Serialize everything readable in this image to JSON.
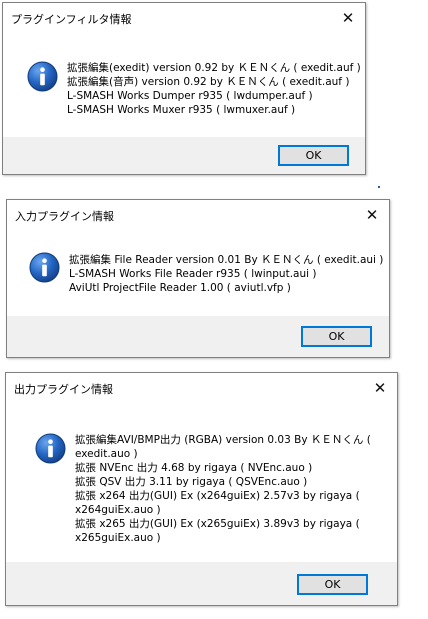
{
  "dialogs": [
    {
      "title": "プラグインフィルタ情報",
      "icon": "info-icon",
      "lines": [
        "拡張編集(exedit) version 0.92 by ＫＥＮくん ( exedit.auf )",
        "拡張編集(音声) version 0.92 by ＫＥＮくん ( exedit.auf )",
        "L-SMASH Works Dumper r935 ( lwdumper.auf )",
        "L-SMASH Works Muxer r935 ( lwmuxer.auf )"
      ],
      "ok_label": "OK",
      "close_label": "✕"
    },
    {
      "title": "入力プラグイン情報",
      "icon": "info-icon",
      "lines": [
        "拡張編集 File Reader version 0.01 By ＫＥＮくん ( exedit.aui )",
        "L-SMASH Works File Reader r935 ( lwinput.aui )",
        "AviUtl ProjectFile Reader 1.00 ( aviutl.vfp )"
      ],
      "ok_label": "OK",
      "close_label": "✕"
    },
    {
      "title": "出力プラグイン情報",
      "icon": "info-icon",
      "lines": [
        "拡張編集AVI/BMP出力 (RGBA) version 0.03 By ＫＥＮくん (",
        "exedit.auo )",
        "拡張 NVEnc 出力 4.68 by rigaya ( NVEnc.auo )",
        "拡張 QSV 出力 3.11 by rigaya ( QSVEnc.auo )",
        "拡張 x264 出力(GUI) Ex (x264guiEx) 2.57v3 by rigaya (",
        "x264guiEx.auo )",
        "拡張 x265 出力(GUI) Ex (x265guiEx) 3.89v3 by rigaya (",
        "x265guiEx.auo )"
      ],
      "ok_label": "OK",
      "close_label": "✕"
    }
  ],
  "colors": {
    "icon_blue": "#1c5fb8",
    "button_border": "#0078d7",
    "dialog_bg": "#f0f0f0"
  }
}
